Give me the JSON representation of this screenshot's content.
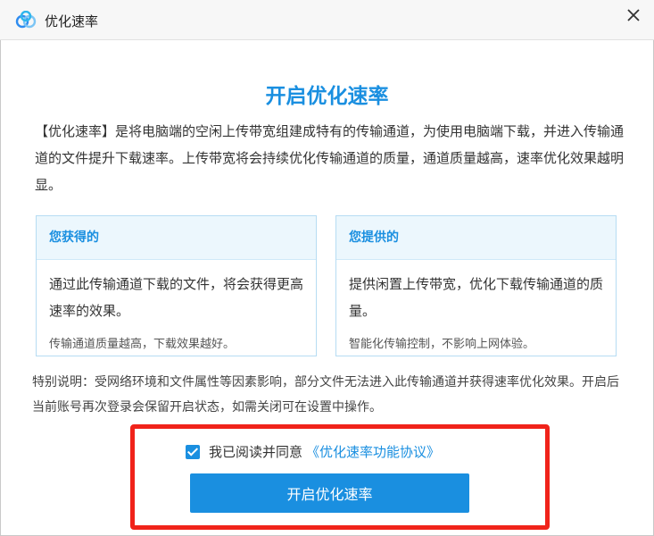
{
  "window": {
    "title": "优化速率",
    "logo_icon": "baidu-netdisk-cloud-icon",
    "close_icon": "close-icon"
  },
  "dialog": {
    "heading": "开启优化速率",
    "intro": "【优化速率】是将电脑端的空闲上传带宽组建成特有的传输通道，为使用电脑端下载，并进入传输通道的文件提升下载速率。上传带宽将会持续优化传输通道的质量，通道质量越高，速率优化效果越明显。",
    "cards": [
      {
        "title": "您获得的",
        "main": "通过此传输通道下载的文件，将会获得更高速率的效果。",
        "note": "传输通道质量越高，下载效果越好。"
      },
      {
        "title": "您提供的",
        "main": "提供闲置上传带宽，优化下载传输通道的质量。",
        "note": "智能化传输控制，不影响上网体验。"
      }
    ],
    "notice": "特别说明：受网络环境和文件属性等因素影响，部分文件无法进入此传输通道并获得速率优化效果。开启后当前账号再次登录会保留开启状态，如需关闭可在设置中操作。",
    "agree": {
      "checked": true,
      "label": "我已阅读并同意",
      "link": "《优化速率功能协议》"
    },
    "button": "开启优化速率"
  },
  "colors": {
    "accent": "#1a8fe0",
    "highlight": "#f0231a",
    "card_header_bg": "#ecf7fd"
  }
}
